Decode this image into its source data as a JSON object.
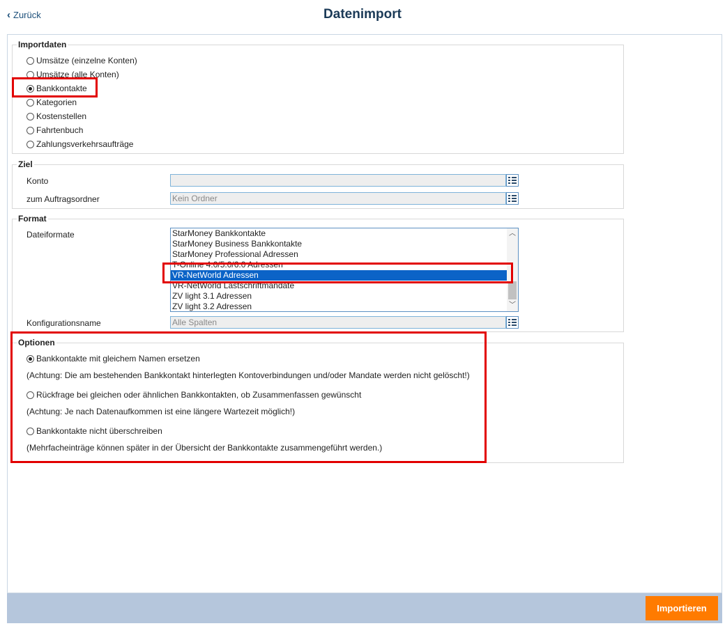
{
  "header": {
    "back_label": "Zurück",
    "title": "Datenimport"
  },
  "importdaten": {
    "legend": "Importdaten",
    "options": [
      {
        "label": "Umsätze (einzelne Konten)",
        "checked": false
      },
      {
        "label": "Umsätze (alle Konten)",
        "checked": false
      },
      {
        "label": "Bankkontakte",
        "checked": true
      },
      {
        "label": "Kategorien",
        "checked": false
      },
      {
        "label": "Kostenstellen",
        "checked": false
      },
      {
        "label": "Fahrtenbuch",
        "checked": false
      },
      {
        "label": "Zahlungsverkehrsaufträge",
        "checked": false
      }
    ]
  },
  "ziel": {
    "legend": "Ziel",
    "konto_label": "Konto",
    "konto_value": "",
    "auftragsordner_label": "zum Auftragsordner",
    "auftragsordner_placeholder": "Kein Ordner"
  },
  "format": {
    "legend": "Format",
    "dateiformate_label": "Dateiformate",
    "dateiformate_items": [
      "StarMoney Bankkontakte",
      "StarMoney Business Bankkontakte",
      "StarMoney Professional Adressen",
      "T-Online 4.0/5.0/6.0 Adressen",
      "VR-NetWorld Adressen",
      "VR-NetWorld Lastschriftmandate",
      "ZV light 3.1 Adressen",
      "ZV light 3.2 Adressen"
    ],
    "selected_item": "VR-NetWorld Adressen",
    "konfigurationsname_label": "Konfigurationsname",
    "konfigurationsname_placeholder": "Alle Spalten"
  },
  "optionen": {
    "legend": "Optionen",
    "opt1_label": "Bankkontakte mit gleichem Namen ersetzen",
    "opt1_checked": true,
    "opt1_note": "(Achtung: Die am bestehenden Bankkontakt hinterlegten Kontoverbindungen und/oder Mandate werden nicht gelöscht!)",
    "opt2_label": "Rückfrage bei gleichen oder ähnlichen Bankkontakten, ob Zusammenfassen gewünscht",
    "opt2_checked": false,
    "opt2_note": "(Achtung: Je nach Datenaufkommen ist eine längere Wartezeit möglich!)",
    "opt3_label": "Bankkontakte nicht überschreiben",
    "opt3_checked": false,
    "opt3_note": "(Mehrfacheinträge können später in der Übersicht der Bankkontakte zusammengeführt werden.)"
  },
  "footer": {
    "import_label": "Importieren"
  },
  "colors": {
    "accent": "#ff7b00",
    "title": "#1b3a57",
    "footer_bg": "#b5c6dc",
    "highlight": "#e20000",
    "selection": "#0b63c7"
  }
}
